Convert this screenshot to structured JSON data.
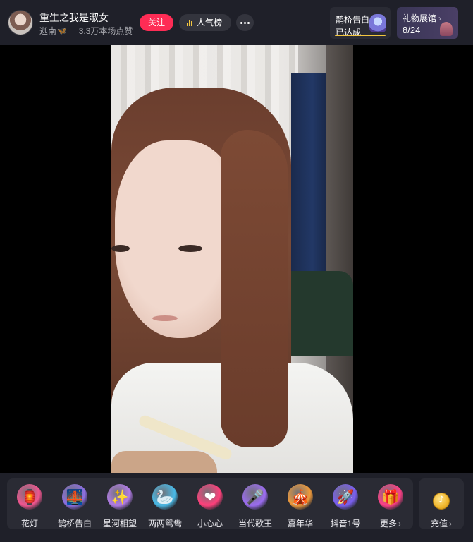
{
  "header": {
    "streamer_name": "重生之我是淑女",
    "host_name": "迦南",
    "likes_text": "3.3万本场点赞",
    "follow_label": "关注",
    "rank_label": "人气榜"
  },
  "goal": {
    "title": "鹊桥告白",
    "status": "已达成",
    "progress": 1.0
  },
  "gallery": {
    "title": "礼物展馆",
    "count": "8/24"
  },
  "gifts": [
    {
      "label": "花灯",
      "icon": "lantern-icon",
      "color": "#f1558f"
    },
    {
      "label": "鹊桥告白",
      "icon": "magpie-bridge-icon",
      "color": "#8c6fe0"
    },
    {
      "label": "星河相望",
      "icon": "star-river-icon",
      "color": "#b17be6"
    },
    {
      "label": "两两鸳鸯",
      "icon": "mandarin-ducks-icon",
      "color": "#49b9e6"
    },
    {
      "label": "小心心",
      "icon": "heart-icon",
      "color": "#ff3f7a"
    },
    {
      "label": "当代歌王",
      "icon": "singer-king-icon",
      "color": "#9b6cf0"
    },
    {
      "label": "嘉年华",
      "icon": "carnival-icon",
      "color": "#f09a3a"
    },
    {
      "label": "抖音1号",
      "icon": "rocket-icon",
      "color": "#7a5ff0"
    },
    {
      "label": "更多",
      "icon": "gift-box-icon",
      "color": "#ff3f86"
    }
  ],
  "recharge": {
    "label": "充值",
    "icon": "coin-icon"
  }
}
